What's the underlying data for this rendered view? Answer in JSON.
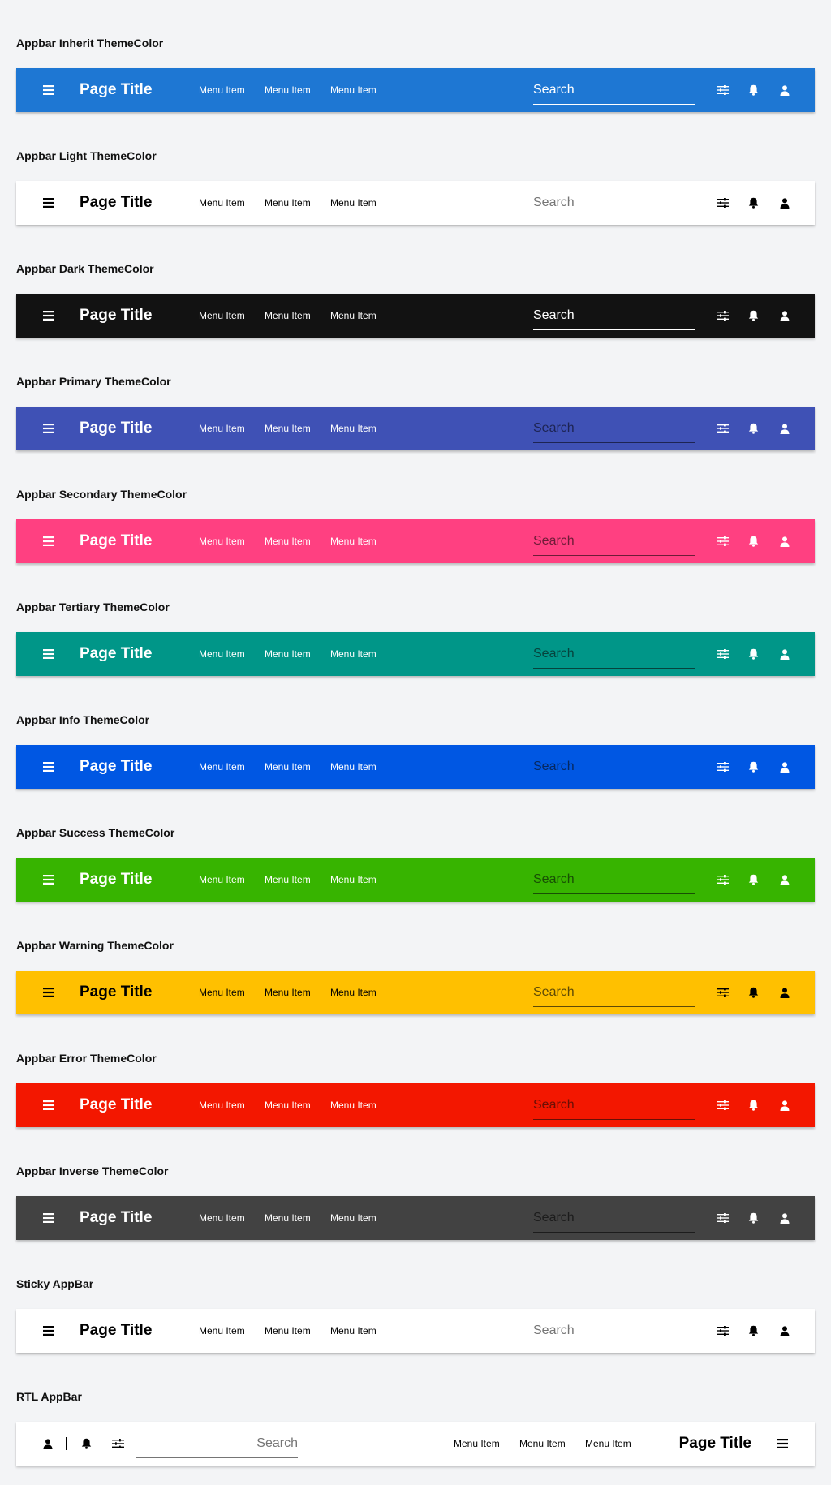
{
  "appbars": [
    {
      "heading": "Appbar Inherit ThemeColor",
      "bg": "#1e77d3",
      "fg": "#ffffff",
      "search_color": "#ffffff",
      "title": "Page Title",
      "menu_items": [
        "Menu Item",
        "Menu Item",
        "Menu Item"
      ],
      "search_placeholder": "Search"
    },
    {
      "heading": "Appbar Light ThemeColor",
      "bg": "#ffffff",
      "fg": "#000000",
      "search_color": "#757575",
      "title": "Page Title",
      "menu_items": [
        "Menu Item",
        "Menu Item",
        "Menu Item"
      ],
      "search_placeholder": "Search"
    },
    {
      "heading": "Appbar Dark ThemeColor",
      "bg": "#121212",
      "fg": "#ffffff",
      "search_color": "#ffffff",
      "title": "Page Title",
      "menu_items": [
        "Menu Item",
        "Menu Item",
        "Menu Item"
      ],
      "search_placeholder": "Search"
    },
    {
      "heading": "Appbar Primary ThemeColor",
      "bg": "#3f51b5",
      "fg": "#ffffff",
      "search_color": "#1d2453",
      "title": "Page Title",
      "menu_items": [
        "Menu Item",
        "Menu Item",
        "Menu Item"
      ],
      "search_placeholder": "Search"
    },
    {
      "heading": "Appbar Secondary ThemeColor",
      "bg": "#ff4081",
      "fg": "#ffffff",
      "search_color": "#6e1c38",
      "title": "Page Title",
      "menu_items": [
        "Menu Item",
        "Menu Item",
        "Menu Item"
      ],
      "search_placeholder": "Search"
    },
    {
      "heading": "Appbar Tertiary ThemeColor",
      "bg": "#009688",
      "fg": "#ffffff",
      "search_color": "#06433d",
      "title": "Page Title",
      "menu_items": [
        "Menu Item",
        "Menu Item",
        "Menu Item"
      ],
      "search_placeholder": "Search"
    },
    {
      "heading": "Appbar Info ThemeColor",
      "bg": "#0057e3",
      "fg": "#ffffff",
      "search_color": "#06285e",
      "title": "Page Title",
      "menu_items": [
        "Menu Item",
        "Menu Item",
        "Menu Item"
      ],
      "search_placeholder": "Search"
    },
    {
      "heading": "Appbar Success ThemeColor",
      "bg": "#37b400",
      "fg": "#ffffff",
      "search_color": "#184f04",
      "title": "Page Title",
      "menu_items": [
        "Menu Item",
        "Menu Item",
        "Menu Item"
      ],
      "search_placeholder": "Search"
    },
    {
      "heading": "Appbar Warning ThemeColor",
      "bg": "#ffc000",
      "fg": "#000000",
      "search_color": "#5e4a06",
      "title": "Page Title",
      "menu_items": [
        "Menu Item",
        "Menu Item",
        "Menu Item"
      ],
      "search_placeholder": "Search"
    },
    {
      "heading": "Appbar Error ThemeColor",
      "bg": "#f31700",
      "fg": "#ffffff",
      "search_color": "#6a0f05",
      "title": "Page Title",
      "menu_items": [
        "Menu Item",
        "Menu Item",
        "Menu Item"
      ],
      "search_placeholder": "Search"
    },
    {
      "heading": "Appbar Inverse ThemeColor",
      "bg": "#424242",
      "fg": "#ffffff",
      "search_color": "#1c1c1c",
      "title": "Page Title",
      "menu_items": [
        "Menu Item",
        "Menu Item",
        "Menu Item"
      ],
      "search_placeholder": "Search"
    },
    {
      "heading": "Sticky AppBar",
      "bg": "#ffffff",
      "fg": "#000000",
      "search_color": "#757575",
      "title": "Page Title",
      "menu_items": [
        "Menu Item",
        "Menu Item",
        "Menu Item"
      ],
      "search_placeholder": "Search"
    },
    {
      "heading": "RTL AppBar",
      "bg": "#ffffff",
      "fg": "#000000",
      "search_color": "#757575",
      "title": "Page Title",
      "menu_items": [
        "Menu Item",
        "Menu Item",
        "Menu Item"
      ],
      "search_placeholder": "Search",
      "direction": "rtl"
    }
  ],
  "icons": {
    "menu": "hamburger-menu-icon",
    "filter": "sliders-icon",
    "notifications": "bell-icon",
    "user": "user-icon"
  }
}
